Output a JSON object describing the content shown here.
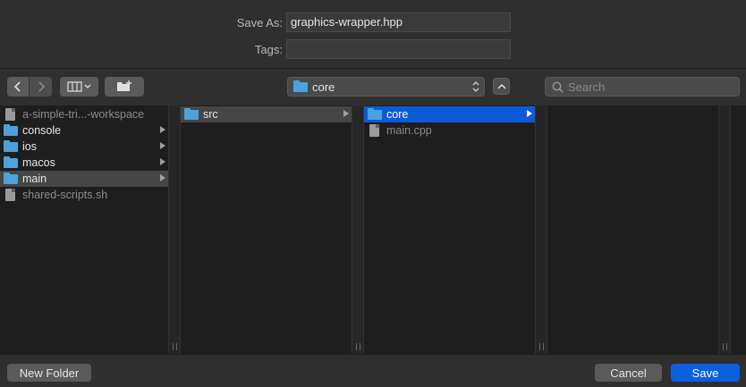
{
  "save_as": {
    "label": "Save As:",
    "value": "graphics-wrapper.hpp"
  },
  "tags": {
    "label": "Tags:",
    "value": ""
  },
  "toolbar": {
    "back_icon": "chevron-left-icon",
    "forward_icon": "chevron-right-icon",
    "view_icon": "column-view-icon",
    "new_folder_icon": "new-folder-icon",
    "location": "core",
    "search_placeholder": "Search"
  },
  "columns": [
    {
      "items": [
        {
          "label": "a-simple-tri...-workspace",
          "kind": "file",
          "dim": true
        },
        {
          "label": "console",
          "kind": "folder",
          "arrow": true
        },
        {
          "label": "ios",
          "kind": "folder",
          "arrow": true
        },
        {
          "label": "macos",
          "kind": "folder",
          "arrow": true
        },
        {
          "label": "main",
          "kind": "folder",
          "arrow": true,
          "selected": "grey"
        },
        {
          "label": "shared-scripts.sh",
          "kind": "file",
          "dim": true
        }
      ]
    },
    {
      "items": [
        {
          "label": "src",
          "kind": "folder",
          "arrow": true,
          "selected": "grey"
        }
      ]
    },
    {
      "items": [
        {
          "label": "core",
          "kind": "folder",
          "arrow": true,
          "selected": "blue"
        },
        {
          "label": "main.cpp",
          "kind": "file",
          "dim": true
        }
      ]
    },
    {
      "items": []
    }
  ],
  "footer": {
    "new_folder": "New Folder",
    "cancel": "Cancel",
    "save": "Save"
  },
  "colors": {
    "accent": "#0b5ad8",
    "folder": "#4aa3df"
  }
}
